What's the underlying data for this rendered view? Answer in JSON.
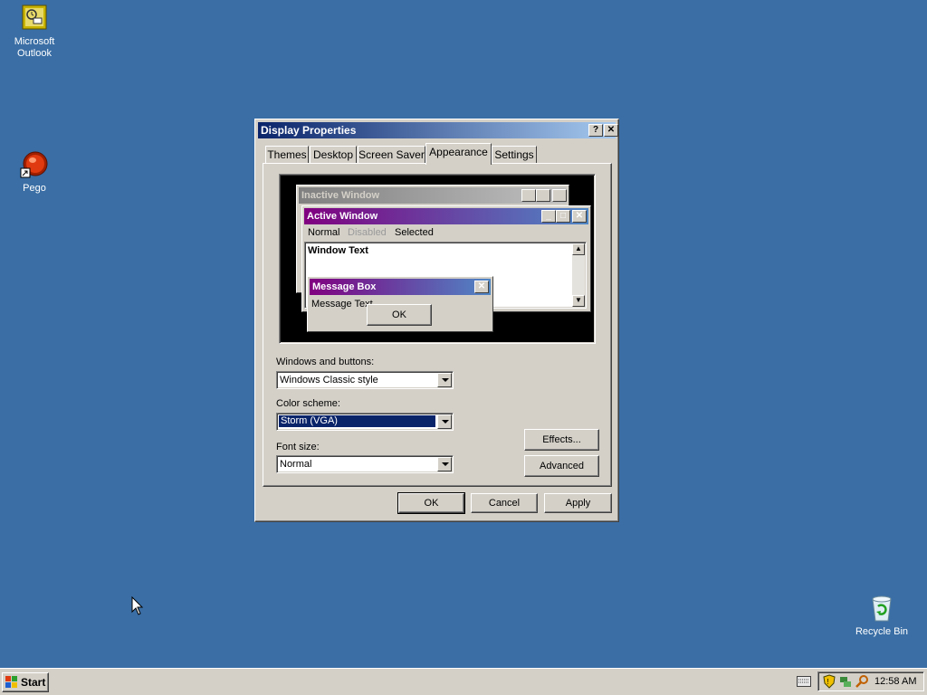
{
  "desktop": {
    "icons": [
      {
        "label": "Microsoft\nOutlook",
        "icon": "outlook-icon"
      },
      {
        "label": "Pego",
        "icon": "pego-shortcut-icon"
      },
      {
        "label": "Recycle Bin",
        "icon": "recycle-bin-icon"
      }
    ]
  },
  "dialog": {
    "title": "Display Properties",
    "help_button": "?",
    "close_button": "✕",
    "tabs": [
      {
        "label": "Themes",
        "active": false
      },
      {
        "label": "Desktop",
        "active": false
      },
      {
        "label": "Screen Saver",
        "active": false
      },
      {
        "label": "Appearance",
        "active": true
      },
      {
        "label": "Settings",
        "active": false
      }
    ],
    "preview": {
      "inactive_title": "Inactive Window",
      "active_title": "Active Window",
      "menu": [
        "Normal",
        "Disabled",
        "Selected"
      ],
      "window_text": "Window Text",
      "msgbox_title": "Message Box",
      "msgbox_text": "Message Text",
      "msgbox_ok": "OK"
    },
    "windows_buttons_label": "Windows and buttons:",
    "windows_buttons_value": "Windows Classic style",
    "color_scheme_label": "Color scheme:",
    "color_scheme_value": "Storm (VGA)",
    "font_size_label": "Font size:",
    "font_size_value": "Normal",
    "effects_button": "Effects...",
    "advanced_button": "Advanced",
    "ok_button": "OK",
    "cancel_button": "Cancel",
    "apply_button": "Apply"
  },
  "taskbar": {
    "start_label": "Start",
    "clock": "12:58 AM"
  },
  "colors": {
    "desktop": "#3a6ea5",
    "active_caption_start": "#800080",
    "active_caption_end": "#4f87c5",
    "selection": "#0a246a"
  }
}
